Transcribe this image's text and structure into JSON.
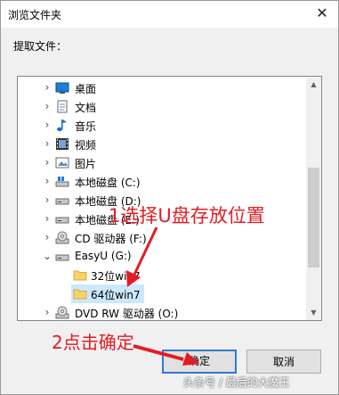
{
  "window": {
    "title": "浏览文件夹",
    "close_glyph": "✕"
  },
  "instruction": "提取文件：",
  "tree": {
    "items": [
      {
        "label": "桌面",
        "icon": "desktop-icon",
        "expanded": false
      },
      {
        "label": "文档",
        "icon": "document-icon",
        "expanded": false
      },
      {
        "label": "音乐",
        "icon": "music-icon",
        "expanded": false
      },
      {
        "label": "视频",
        "icon": "video-icon",
        "expanded": false
      },
      {
        "label": "图片",
        "icon": "picture-icon",
        "expanded": false
      },
      {
        "label": "本地磁盘 (C:)",
        "icon": "system-drive-icon",
        "expanded": false
      },
      {
        "label": "本地磁盘 (D:)",
        "icon": "drive-icon",
        "expanded": false
      },
      {
        "label": "本地磁盘 (E:)",
        "icon": "drive-icon",
        "expanded": false
      },
      {
        "label": "CD 驱动器 (F:)",
        "icon": "cd-drive-icon",
        "expanded": false
      },
      {
        "label": "EasyU (G:)",
        "icon": "usb-drive-icon",
        "expanded": true
      },
      {
        "label": "32位win7",
        "icon": "folder-icon",
        "child": true
      },
      {
        "label": "64位win7",
        "icon": "folder-icon",
        "child": true,
        "selected": true
      },
      {
        "label": "DVD RW 驱动器 (O:)",
        "icon": "dvd-drive-icon",
        "expanded": false
      }
    ]
  },
  "buttons": {
    "ok": "确定",
    "cancel": "取消"
  },
  "annotations": {
    "step1": "1选择U盘存放位置",
    "step2": "2点击确定"
  },
  "watermark": "头条号 / 最后的大魔王",
  "colors": {
    "annotation": "#e31c23",
    "selection": "#cce8ff",
    "focus": "#3078d6"
  }
}
